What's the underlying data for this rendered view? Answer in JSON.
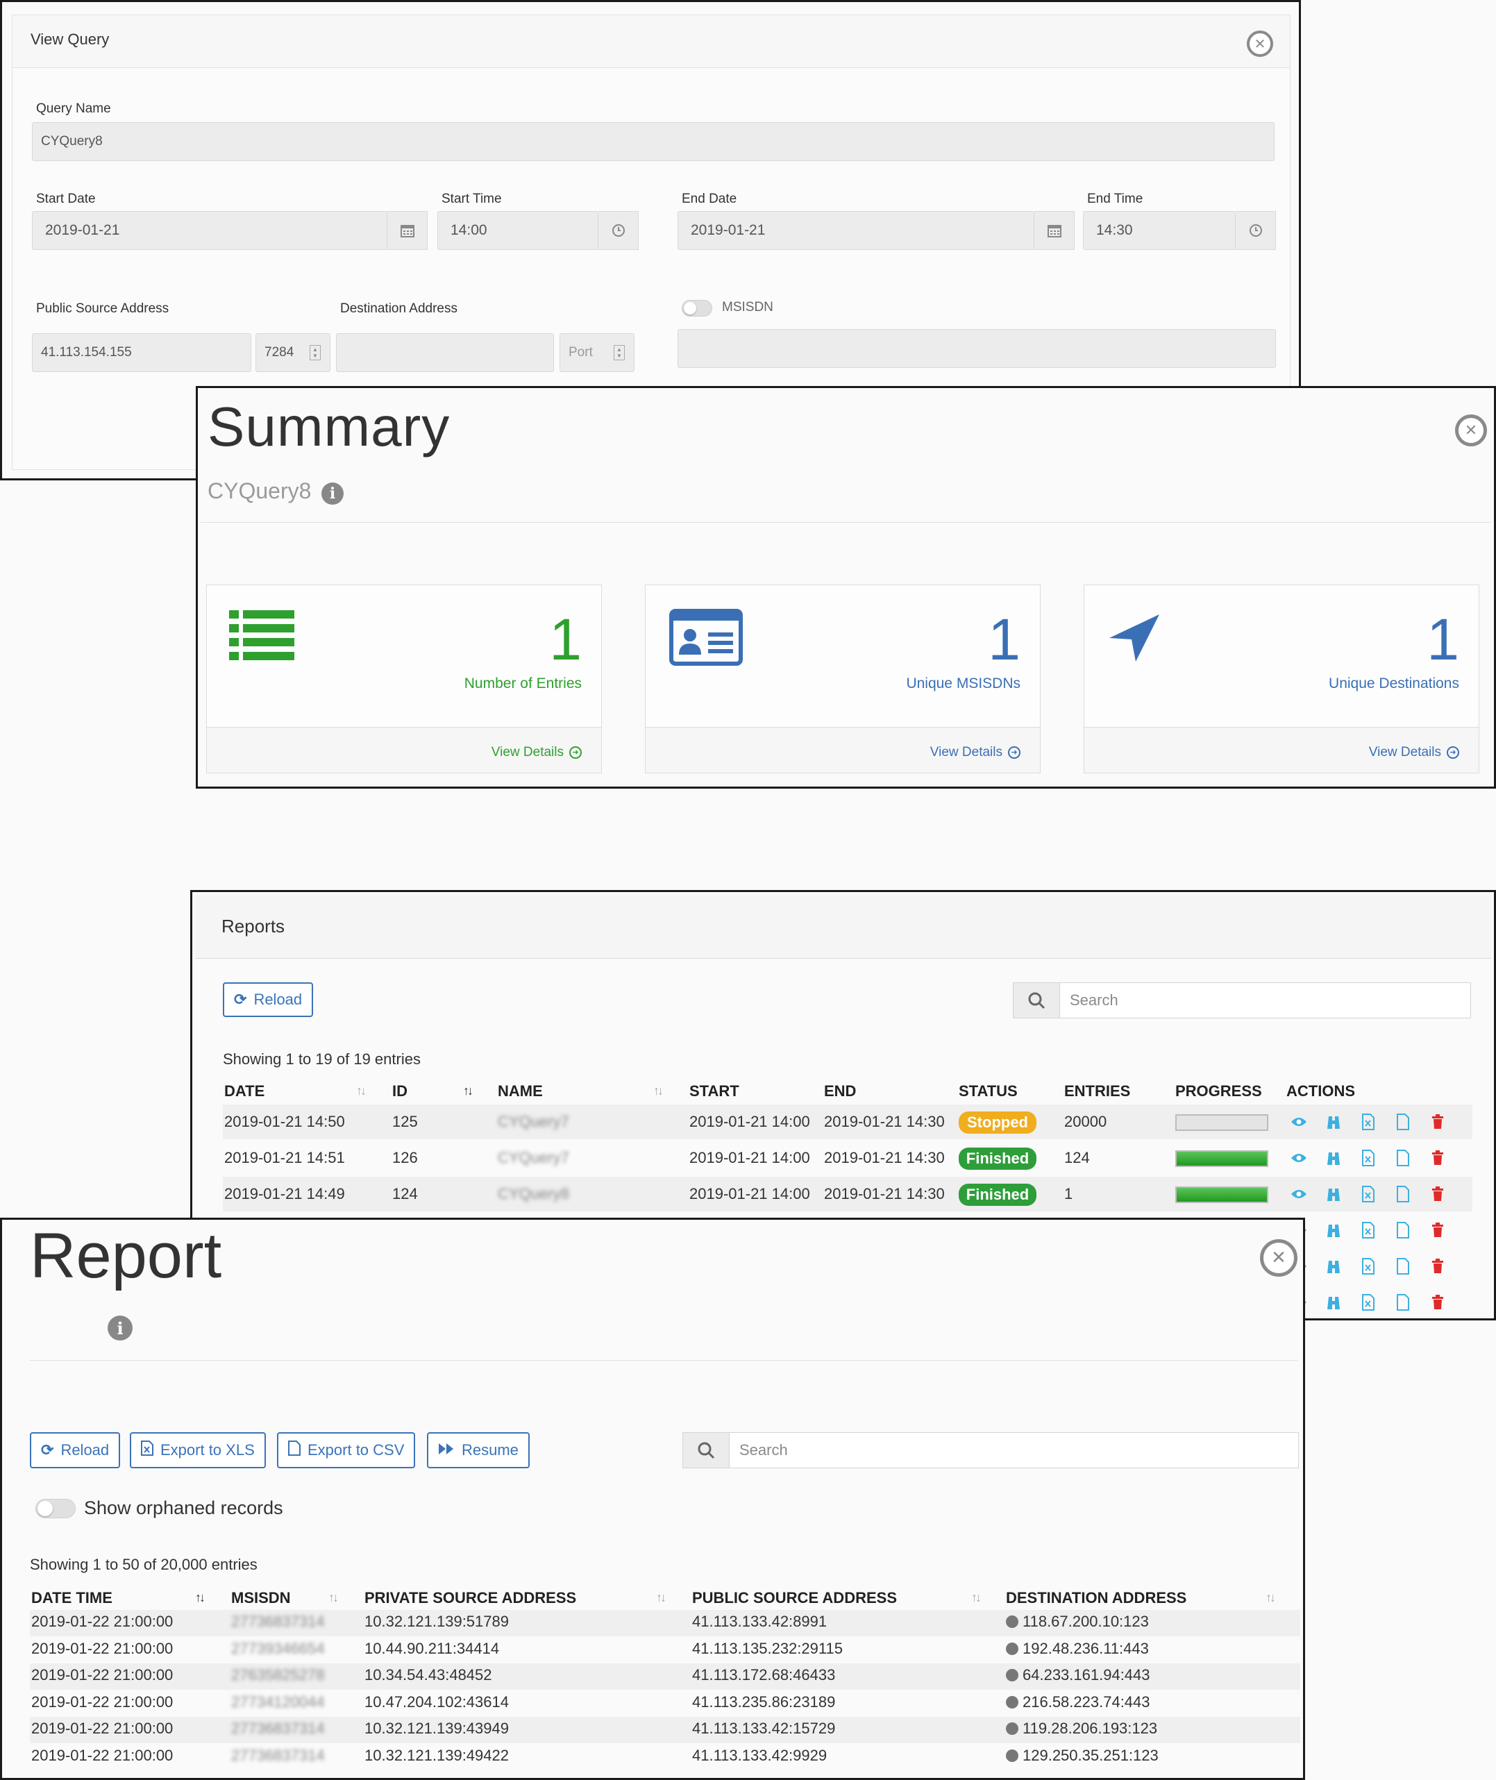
{
  "view_query": {
    "title": "View Query",
    "query_name_label": "Query Name",
    "query_name_value": "CYQuery8",
    "start_date_label": "Start Date",
    "start_date_value": "2019-01-21",
    "start_time_label": "Start Time",
    "start_time_value": "14:00",
    "end_date_label": "End Date",
    "end_date_value": "2019-01-21",
    "end_time_label": "End Time",
    "end_time_value": "14:30",
    "public_source_label": "Public Source Address",
    "public_source_value": "41.113.154.155",
    "public_source_port": "7284",
    "destination_label": "Destination Address",
    "destination_value": "",
    "destination_port_placeholder": "Port",
    "msisdn_label": "MSISDN",
    "msisdn_value": ""
  },
  "summary": {
    "title": "Summary",
    "subtitle": "CYQuery8",
    "cards": [
      {
        "icon": "list-icon",
        "value": "1",
        "caption": "Number of Entries",
        "details": "View Details",
        "color": "#2ea02e"
      },
      {
        "icon": "id-card-icon",
        "value": "1",
        "caption": "Unique MSISDNs",
        "details": "View Details",
        "color": "#3a6fb5"
      },
      {
        "icon": "location-arrow-icon",
        "value": "1",
        "caption": "Unique Destinations",
        "details": "View Details",
        "color": "#3a6fb5"
      }
    ]
  },
  "reports": {
    "title": "Reports",
    "reload": "Reload",
    "search_placeholder": "Search",
    "showing": "Showing 1 to 19 of 19 entries",
    "columns": [
      "DATE",
      "ID",
      "NAME",
      "START",
      "END",
      "STATUS",
      "ENTRIES",
      "PROGRESS",
      "ACTIONS"
    ],
    "rows": [
      {
        "date": "2019-01-21 14:50",
        "id": "125",
        "name": "CYQuery7",
        "start": "2019-01-21 14:00",
        "end": "2019-01-21 14:30",
        "status": "Stopped",
        "entries": "20000",
        "progress": 0
      },
      {
        "date": "2019-01-21 14:51",
        "id": "126",
        "name": "CYQuery7",
        "start": "2019-01-21 14:00",
        "end": "2019-01-21 14:30",
        "status": "Finished",
        "entries": "124",
        "progress": 100
      },
      {
        "date": "2019-01-21 14:49",
        "id": "124",
        "name": "CYQuery8",
        "start": "2019-01-21 14:00",
        "end": "2019-01-21 14:30",
        "status": "Finished",
        "entries": "1",
        "progress": 100
      }
    ],
    "status_colors": {
      "Stopped": "#f0ad1e",
      "Finished": "#2e9e3a"
    }
  },
  "report": {
    "title": "Report",
    "reload": "Reload",
    "export_xls": "Export to XLS",
    "export_csv": "Export to CSV",
    "resume": "Resume",
    "search_placeholder": "Search",
    "show_orphaned": "Show orphaned records",
    "showing": "Showing 1 to 50 of 20,000 entries",
    "columns": [
      "DATE TIME",
      "MSISDN",
      "PRIVATE SOURCE ADDRESS",
      "PUBLIC SOURCE ADDRESS",
      "DESTINATION ADDRESS"
    ],
    "rows": [
      {
        "datetime": "2019-01-22 21:00:00",
        "msisdn": "27736837314",
        "private": "10.32.121.139:51789",
        "public": "41.113.133.42:8991",
        "dest": "118.67.200.10:123"
      },
      {
        "datetime": "2019-01-22 21:00:00",
        "msisdn": "27739346654",
        "private": "10.44.90.211:34414",
        "public": "41.113.135.232:29115",
        "dest": "192.48.236.11:443"
      },
      {
        "datetime": "2019-01-22 21:00:00",
        "msisdn": "27635825278",
        "private": "10.34.54.43:48452",
        "public": "41.113.172.68:46433",
        "dest": "64.233.161.94:443"
      },
      {
        "datetime": "2019-01-22 21:00:00",
        "msisdn": "27734120044",
        "private": "10.47.204.102:43614",
        "public": "41.113.235.86:23189",
        "dest": "216.58.223.74:443"
      },
      {
        "datetime": "2019-01-22 21:00:00",
        "msisdn": "27736837314",
        "private": "10.32.121.139:43949",
        "public": "41.113.133.42:15729",
        "dest": "119.28.206.193:123"
      },
      {
        "datetime": "2019-01-22 21:00:00",
        "msisdn": "27736837314",
        "private": "10.32.121.139:49422",
        "public": "41.113.133.42:9929",
        "dest": "129.250.35.251:123"
      }
    ]
  }
}
